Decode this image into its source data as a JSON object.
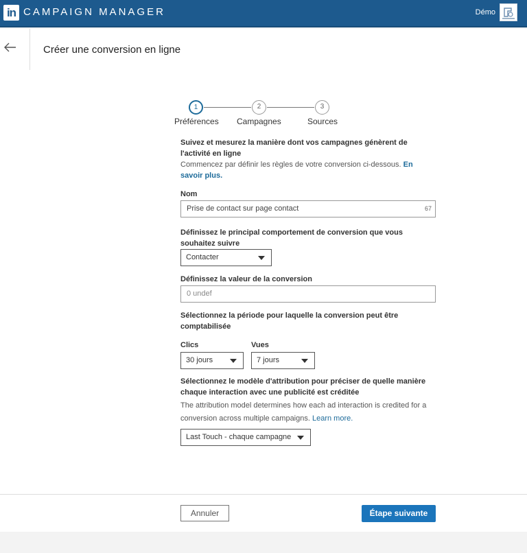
{
  "topbar": {
    "logo_text": "in",
    "app_title": "CAMPAIGN MANAGER",
    "account_name": "Démo",
    "brand_color": "#1d5a8e"
  },
  "header": {
    "back_icon": "arrow-left-icon",
    "title": "Créer une conversion en ligne"
  },
  "stepper": {
    "steps": [
      {
        "number": "1",
        "label": "Préférences",
        "active": true
      },
      {
        "number": "2",
        "label": "Campagnes",
        "active": false
      },
      {
        "number": "3",
        "label": "Sources",
        "active": false
      }
    ]
  },
  "form": {
    "intro_title": "Suivez et mesurez la manière dont vos campagnes génèrent de l'activité en ligne",
    "intro_text": "Commencez par définir les règles de votre conversion ci-dessous.",
    "learn_more_fr": "En savoir plus.",
    "name_label": "Nom",
    "name_value": "Prise de contact sur page contact",
    "name_counter": "67",
    "behavior_label": "Définissez le principal comportement de conversion que vous souhaitez suivre",
    "behavior_value": "Contacter",
    "value_label": "Définissez la valeur de la conversion",
    "value_placeholder": "0 undef",
    "period_label": "Sélectionnez la période pour laquelle la conversion peut être comptabilisée",
    "clicks_label": "Clics",
    "clicks_value": "30 jours",
    "views_label": "Vues",
    "views_value": "7 jours",
    "attribution_label": "Sélectionnez le modèle d'attribution pour préciser de quelle manière chaque interaction avec une publicité est créditée",
    "attribution_desc": "The attribution model determines how each ad interaction is credited for a conversion across multiple campaigns.",
    "learn_more_en": "Learn more.",
    "attribution_value": "Last Touch - chaque campagne"
  },
  "footer": {
    "cancel_label": "Annuler",
    "next_label": "Étape suivante",
    "accent_color": "#1b75bb"
  }
}
